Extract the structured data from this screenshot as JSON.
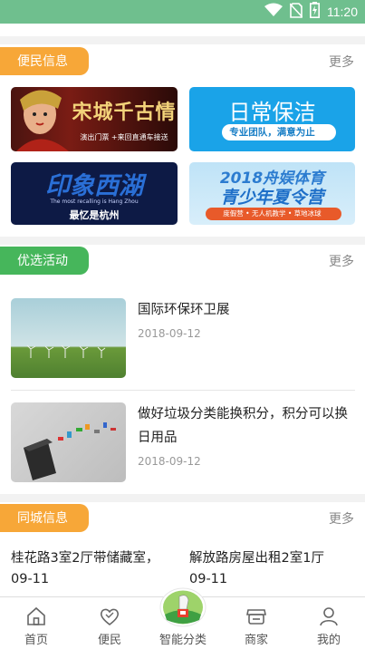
{
  "status_bar": {
    "time": "11:20",
    "wifi_icon": "wifi-icon",
    "sim_icon": "no-sim-icon",
    "battery_icon": "battery-charging-icon"
  },
  "colors": {
    "status_bar": "#6fbf8e",
    "orange": "#f7a738",
    "green": "#46b65b"
  },
  "convenience": {
    "tag": "便民信息",
    "more": "更多",
    "banners": [
      {
        "title": "宋城千古情",
        "sub": "演出门票 +来回直通车接送"
      },
      {
        "title": "日常保洁",
        "sub": "专业团队，满意为止"
      },
      {
        "title": "印象西湖",
        "sub": "最忆是杭州",
        "tiny": "The most recalling is Hang Zhou"
      },
      {
        "title": "2018舟娱体育",
        "title2": "青少年夏令营",
        "sub": "度假营 • 无人机教学 • 草地冰球"
      }
    ]
  },
  "activities": {
    "tag": "优选活动",
    "more": "更多",
    "items": [
      {
        "title": "国际环保环卫展",
        "date": "2018-09-12"
      },
      {
        "title": "做好垃圾分类能换积分，积分可以换日用品",
        "date": "2018-09-12"
      }
    ]
  },
  "city": {
    "tag": "同城信息",
    "more": "更多",
    "items": [
      {
        "title": "桂花路3室2厅带储藏室，",
        "date": "09-11"
      },
      {
        "title": "解放路房屋出租2室1厅",
        "date": "09-11"
      }
    ]
  },
  "nav": {
    "items": [
      {
        "label": "首页",
        "icon": "home-icon"
      },
      {
        "label": "便民",
        "icon": "heart-icon"
      },
      {
        "label": "智能分类",
        "icon": "smart-sort-icon"
      },
      {
        "label": "商家",
        "icon": "store-icon"
      },
      {
        "label": "我的",
        "icon": "user-icon"
      }
    ]
  }
}
